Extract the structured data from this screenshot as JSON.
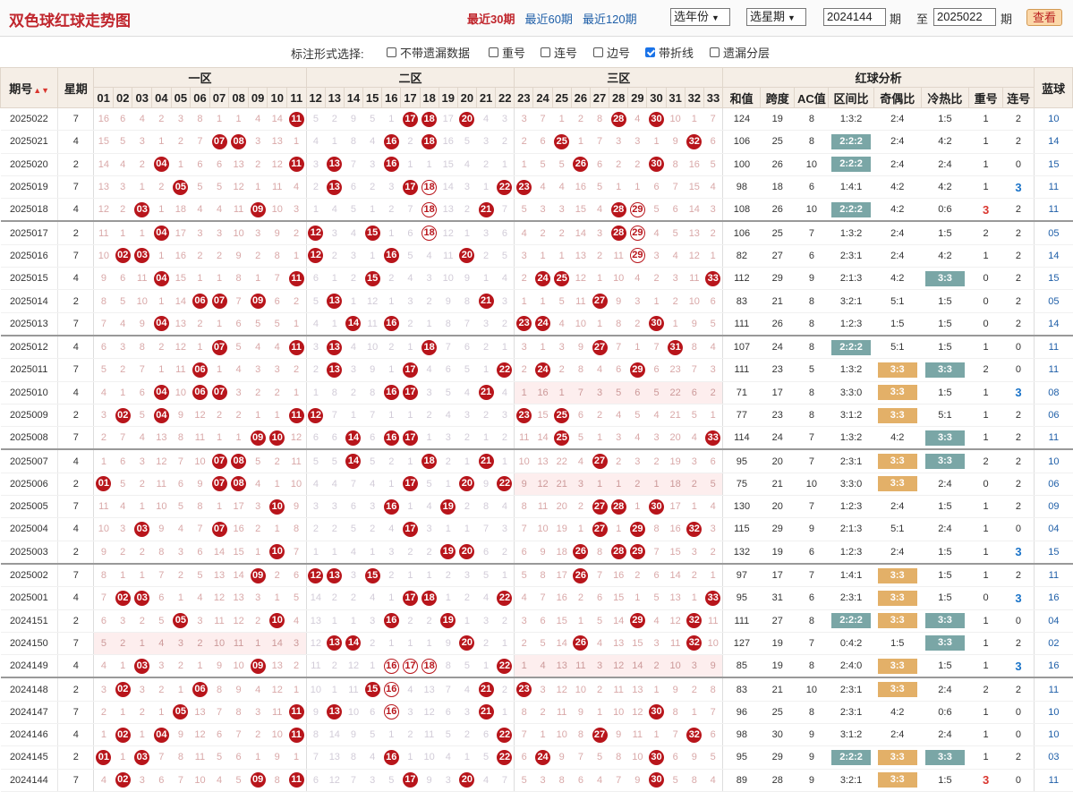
{
  "app_title": "双色球红球走势图",
  "period_links": [
    "最近30期",
    "最近60期",
    "最近120期"
  ],
  "period_active": 0,
  "year_select": "选年份",
  "week_select": "选星期",
  "issue_from": "2024144",
  "issue_from_unit": "期",
  "range_sep": "至",
  "issue_to": "2025022",
  "issue_to_unit": "期",
  "query_button": "查看",
  "options_label": "标注形式选择:",
  "options": [
    {
      "label": "不带遗漏数据",
      "checked": false
    },
    {
      "label": "重号",
      "checked": false
    },
    {
      "label": "连号",
      "checked": false
    },
    {
      "label": "边号",
      "checked": false
    },
    {
      "label": "带折线",
      "checked": true
    },
    {
      "label": "遗漏分层",
      "checked": false
    }
  ],
  "headers": {
    "issue": "期号",
    "week": "星期",
    "zone1": "一区",
    "zone2": "二区",
    "zone3": "三区",
    "analysis": "红球分析",
    "blue": "蓝球",
    "numbers": [
      "01",
      "02",
      "03",
      "04",
      "05",
      "06",
      "07",
      "08",
      "09",
      "10",
      "11",
      "12",
      "13",
      "14",
      "15",
      "16",
      "17",
      "18",
      "19",
      "20",
      "21",
      "22",
      "23",
      "24",
      "25",
      "26",
      "27",
      "28",
      "29",
      "30",
      "31",
      "32",
      "33"
    ],
    "analysis_cols": [
      "和值",
      "跨度",
      "AC值",
      "区间比",
      "奇偶比",
      "冷热比",
      "重号",
      "连号"
    ]
  },
  "colors": {
    "ball_red": "#b8151b",
    "tag_green": "#7aa6a6",
    "tag_orange": "#e3b068",
    "blue_text": "#1f5fa8",
    "highlight_blue": "#1a73c8",
    "highlight_red": "#d9362f"
  },
  "rows": [
    {
      "issue": "2025022",
      "week": "7",
      "reds": [
        11,
        17,
        18,
        20,
        28,
        30
      ],
      "rings": [],
      "sum": "124",
      "span": "19",
      "ac": "8",
      "zone": "1:3:2",
      "odd": "2:4",
      "hot": "1:5",
      "rep": "1",
      "con": "2",
      "blue": "10"
    },
    {
      "issue": "2025021",
      "week": "4",
      "reds": [
        7,
        8,
        16,
        18,
        25,
        32
      ],
      "rings": [],
      "sum": "106",
      "span": "25",
      "ac": "8",
      "zone": "2:2:2",
      "zoneTag": "g",
      "odd": "2:4",
      "hot": "4:2",
      "rep": "1",
      "con": "2",
      "blue": "14"
    },
    {
      "issue": "2025020",
      "week": "2",
      "reds": [
        4,
        11,
        13,
        16,
        26,
        30
      ],
      "rings": [],
      "sum": "100",
      "span": "26",
      "ac": "10",
      "zone": "2:2:2",
      "zoneTag": "g",
      "odd": "2:4",
      "hot": "2:4",
      "rep": "1",
      "con": "0",
      "blue": "15"
    },
    {
      "issue": "2025019",
      "week": "7",
      "reds": [
        5,
        13,
        17,
        22,
        23
      ],
      "rings": [
        18
      ],
      "sum": "98",
      "span": "18",
      "ac": "6",
      "zone": "1:4:1",
      "odd": "4:2",
      "hot": "4:2",
      "rep": "1",
      "con": "3",
      "conHl": "b",
      "blue": "11"
    },
    {
      "issue": "2025018",
      "week": "4",
      "reds": [
        3,
        9,
        21,
        28
      ],
      "rings": [
        18,
        29
      ],
      "sum": "108",
      "span": "26",
      "ac": "10",
      "zone": "2:2:2",
      "zoneTag": "g",
      "odd": "4:2",
      "hot": "0:6",
      "rep": "3",
      "repHl": "r",
      "con": "2",
      "blue": "11"
    },
    {
      "issue": "2025017",
      "week": "2",
      "reds": [
        4,
        12,
        15,
        28
      ],
      "rings": [
        18,
        29
      ],
      "sum": "106",
      "span": "25",
      "ac": "7",
      "zone": "1:3:2",
      "odd": "2:4",
      "hot": "1:5",
      "rep": "2",
      "con": "2",
      "blue": "05",
      "sep": true
    },
    {
      "issue": "2025016",
      "week": "7",
      "reds": [
        2,
        3,
        12,
        16,
        20
      ],
      "rings": [
        29
      ],
      "sum": "82",
      "span": "27",
      "ac": "6",
      "zone": "2:3:1",
      "odd": "2:4",
      "hot": "4:2",
      "rep": "1",
      "con": "2",
      "blue": "14"
    },
    {
      "issue": "2025015",
      "week": "4",
      "reds": [
        4,
        11,
        15,
        24,
        25,
        33
      ],
      "rings": [],
      "sum": "112",
      "span": "29",
      "ac": "9",
      "zone": "2:1:3",
      "odd": "4:2",
      "hot": "3:3",
      "hotTag": "g",
      "rep": "0",
      "con": "2",
      "blue": "15"
    },
    {
      "issue": "2025014",
      "week": "2",
      "reds": [
        6,
        7,
        9,
        13,
        21,
        27
      ],
      "rings": [],
      "sum": "83",
      "span": "21",
      "ac": "8",
      "zone": "3:2:1",
      "odd": "5:1",
      "hot": "1:5",
      "rep": "0",
      "con": "2",
      "blue": "05"
    },
    {
      "issue": "2025013",
      "week": "7",
      "reds": [
        4,
        14,
        16,
        23,
        24,
        30
      ],
      "rings": [],
      "sum": "111",
      "span": "26",
      "ac": "8",
      "zone": "1:2:3",
      "odd": "1:5",
      "hot": "1:5",
      "rep": "0",
      "con": "2",
      "blue": "14"
    },
    {
      "issue": "2025012",
      "week": "4",
      "reds": [
        7,
        11,
        13,
        18,
        27,
        31
      ],
      "rings": [],
      "sum": "107",
      "span": "24",
      "ac": "8",
      "zone": "2:2:2",
      "zoneTag": "g",
      "odd": "5:1",
      "hot": "1:5",
      "rep": "1",
      "con": "0",
      "blue": "11",
      "sep": true
    },
    {
      "issue": "2025011",
      "week": "7",
      "reds": [
        6,
        13,
        17,
        22,
        24,
        29
      ],
      "rings": [],
      "sum": "111",
      "span": "23",
      "ac": "5",
      "zone": "1:3:2",
      "odd": "3:3",
      "oddTag": "o",
      "hot": "3:3",
      "hotTag": "g",
      "rep": "2",
      "con": "0",
      "blue": "11"
    },
    {
      "issue": "2025010",
      "week": "4",
      "reds": [
        4,
        6,
        7,
        16,
        17,
        21
      ],
      "rings": [],
      "sum": "71",
      "span": "17",
      "ac": "8",
      "zone": "3:3:0",
      "odd": "3:3",
      "oddTag": "o",
      "hot": "1:5",
      "rep": "1",
      "con": "3",
      "conHl": "b",
      "blue": "08",
      "hotZone3": true
    },
    {
      "issue": "2025009",
      "week": "2",
      "reds": [
        2,
        4,
        11,
        12,
        23,
        25
      ],
      "rings": [],
      "sum": "77",
      "span": "23",
      "ac": "8",
      "zone": "3:1:2",
      "odd": "3:3",
      "oddTag": "o",
      "hot": "5:1",
      "rep": "1",
      "con": "2",
      "blue": "06"
    },
    {
      "issue": "2025008",
      "week": "7",
      "reds": [
        9,
        10,
        14,
        16,
        17,
        25,
        33
      ],
      "rings": [],
      "sum": "114",
      "span": "24",
      "ac": "7",
      "zone": "1:3:2",
      "odd": "4:2",
      "hot": "3:3",
      "hotTag": "g",
      "rep": "1",
      "con": "2",
      "blue": "11"
    },
    {
      "issue": "2025007",
      "week": "4",
      "reds": [
        7,
        8,
        14,
        18,
        21,
        27
      ],
      "rings": [],
      "sum": "95",
      "span": "20",
      "ac": "7",
      "zone": "2:3:1",
      "odd": "3:3",
      "oddTag": "o",
      "hot": "3:3",
      "hotTag": "g",
      "rep": "2",
      "con": "2",
      "blue": "10",
      "sep": true
    },
    {
      "issue": "2025006",
      "week": "2",
      "reds": [
        1,
        7,
        8,
        17,
        20,
        22
      ],
      "rings": [],
      "sum": "75",
      "span": "21",
      "ac": "10",
      "zone": "3:3:0",
      "odd": "3:3",
      "oddTag": "o",
      "hot": "2:4",
      "rep": "0",
      "con": "2",
      "blue": "06",
      "hotZone3": true
    },
    {
      "issue": "2025005",
      "week": "7",
      "reds": [
        10,
        16,
        19,
        27,
        28,
        30
      ],
      "rings": [],
      "sum": "130",
      "span": "20",
      "ac": "7",
      "zone": "1:2:3",
      "odd": "2:4",
      "hot": "1:5",
      "rep": "1",
      "con": "2",
      "blue": "09"
    },
    {
      "issue": "2025004",
      "week": "4",
      "reds": [
        3,
        7,
        17,
        27,
        29,
        32
      ],
      "rings": [],
      "sum": "115",
      "span": "29",
      "ac": "9",
      "zone": "2:1:3",
      "odd": "5:1",
      "hot": "2:4",
      "rep": "1",
      "con": "0",
      "blue": "04"
    },
    {
      "issue": "2025003",
      "week": "2",
      "reds": [
        10,
        19,
        20,
        26,
        28,
        29
      ],
      "rings": [],
      "sum": "132",
      "span": "19",
      "ac": "6",
      "zone": "1:2:3",
      "odd": "2:4",
      "hot": "1:5",
      "rep": "1",
      "con": "3",
      "conHl": "b",
      "blue": "15"
    },
    {
      "issue": "2025002",
      "week": "7",
      "reds": [
        9,
        12,
        13,
        15,
        26
      ],
      "rings": [],
      "sum": "97",
      "span": "17",
      "ac": "7",
      "zone": "1:4:1",
      "odd": "3:3",
      "oddTag": "o",
      "hot": "1:5",
      "rep": "1",
      "con": "2",
      "blue": "11",
      "sep": true
    },
    {
      "issue": "2025001",
      "week": "4",
      "reds": [
        2,
        3,
        17,
        18,
        22,
        33
      ],
      "rings": [],
      "sum": "95",
      "span": "31",
      "ac": "6",
      "zone": "2:3:1",
      "odd": "3:3",
      "oddTag": "o",
      "hot": "1:5",
      "rep": "0",
      "con": "3",
      "conHl": "b",
      "blue": "16"
    },
    {
      "issue": "2024151",
      "week": "2",
      "reds": [
        5,
        10,
        16,
        19,
        29,
        32
      ],
      "rings": [],
      "sum": "111",
      "span": "27",
      "ac": "8",
      "zone": "2:2:2",
      "zoneTag": "g",
      "odd": "3:3",
      "oddTag": "o",
      "hot": "3:3",
      "hotTag": "g",
      "rep": "1",
      "con": "0",
      "blue": "04"
    },
    {
      "issue": "2024150",
      "week": "7",
      "reds": [
        13,
        14,
        20,
        26,
        32
      ],
      "rings": [],
      "sum": "127",
      "span": "19",
      "ac": "7",
      "zone": "0:4:2",
      "odd": "1:5",
      "hot": "3:3",
      "hotTag": "g",
      "rep": "1",
      "con": "2",
      "blue": "02",
      "hotZone1": true
    },
    {
      "issue": "2024149",
      "week": "4",
      "reds": [
        3,
        9,
        22
      ],
      "rings": [
        16,
        17,
        18
      ],
      "sum": "85",
      "span": "19",
      "ac": "8",
      "zone": "2:4:0",
      "odd": "3:3",
      "oddTag": "o",
      "hot": "1:5",
      "rep": "1",
      "con": "3",
      "conHl": "b",
      "blue": "16",
      "hotZone3": true
    },
    {
      "issue": "2024148",
      "week": "2",
      "reds": [
        2,
        6,
        15,
        21,
        23
      ],
      "rings": [
        16
      ],
      "sum": "83",
      "span": "21",
      "ac": "10",
      "zone": "2:3:1",
      "odd": "3:3",
      "oddTag": "o",
      "hot": "2:4",
      "rep": "2",
      "con": "2",
      "blue": "11",
      "sep": true
    },
    {
      "issue": "2024147",
      "week": "7",
      "reds": [
        5,
        11,
        13,
        21,
        30
      ],
      "rings": [
        16
      ],
      "sum": "96",
      "span": "25",
      "ac": "8",
      "zone": "2:3:1",
      "odd": "4:2",
      "hot": "0:6",
      "rep": "1",
      "con": "0",
      "blue": "10"
    },
    {
      "issue": "2024146",
      "week": "4",
      "reds": [
        2,
        4,
        11,
        22,
        27,
        32
      ],
      "rings": [],
      "sum": "98",
      "span": "30",
      "ac": "9",
      "zone": "3:1:2",
      "odd": "2:4",
      "hot": "2:4",
      "rep": "1",
      "con": "0",
      "blue": "10"
    },
    {
      "issue": "2024145",
      "week": "2",
      "reds": [
        1,
        3,
        16,
        22,
        24,
        30
      ],
      "rings": [],
      "sum": "95",
      "span": "29",
      "ac": "9",
      "zone": "2:2:2",
      "zoneTag": "g",
      "odd": "3:3",
      "oddTag": "o",
      "hot": "3:3",
      "hotTag": "g",
      "rep": "1",
      "con": "2",
      "blue": "03"
    },
    {
      "issue": "2024144",
      "week": "7",
      "reds": [
        2,
        9,
        11,
        17,
        20,
        30
      ],
      "rings": [],
      "sum": "89",
      "span": "28",
      "ac": "9",
      "zone": "3:2:1",
      "odd": "3:3",
      "oddTag": "o",
      "hot": "1:5",
      "rep": "3",
      "repHl": "r",
      "con": "0",
      "blue": "11"
    }
  ]
}
